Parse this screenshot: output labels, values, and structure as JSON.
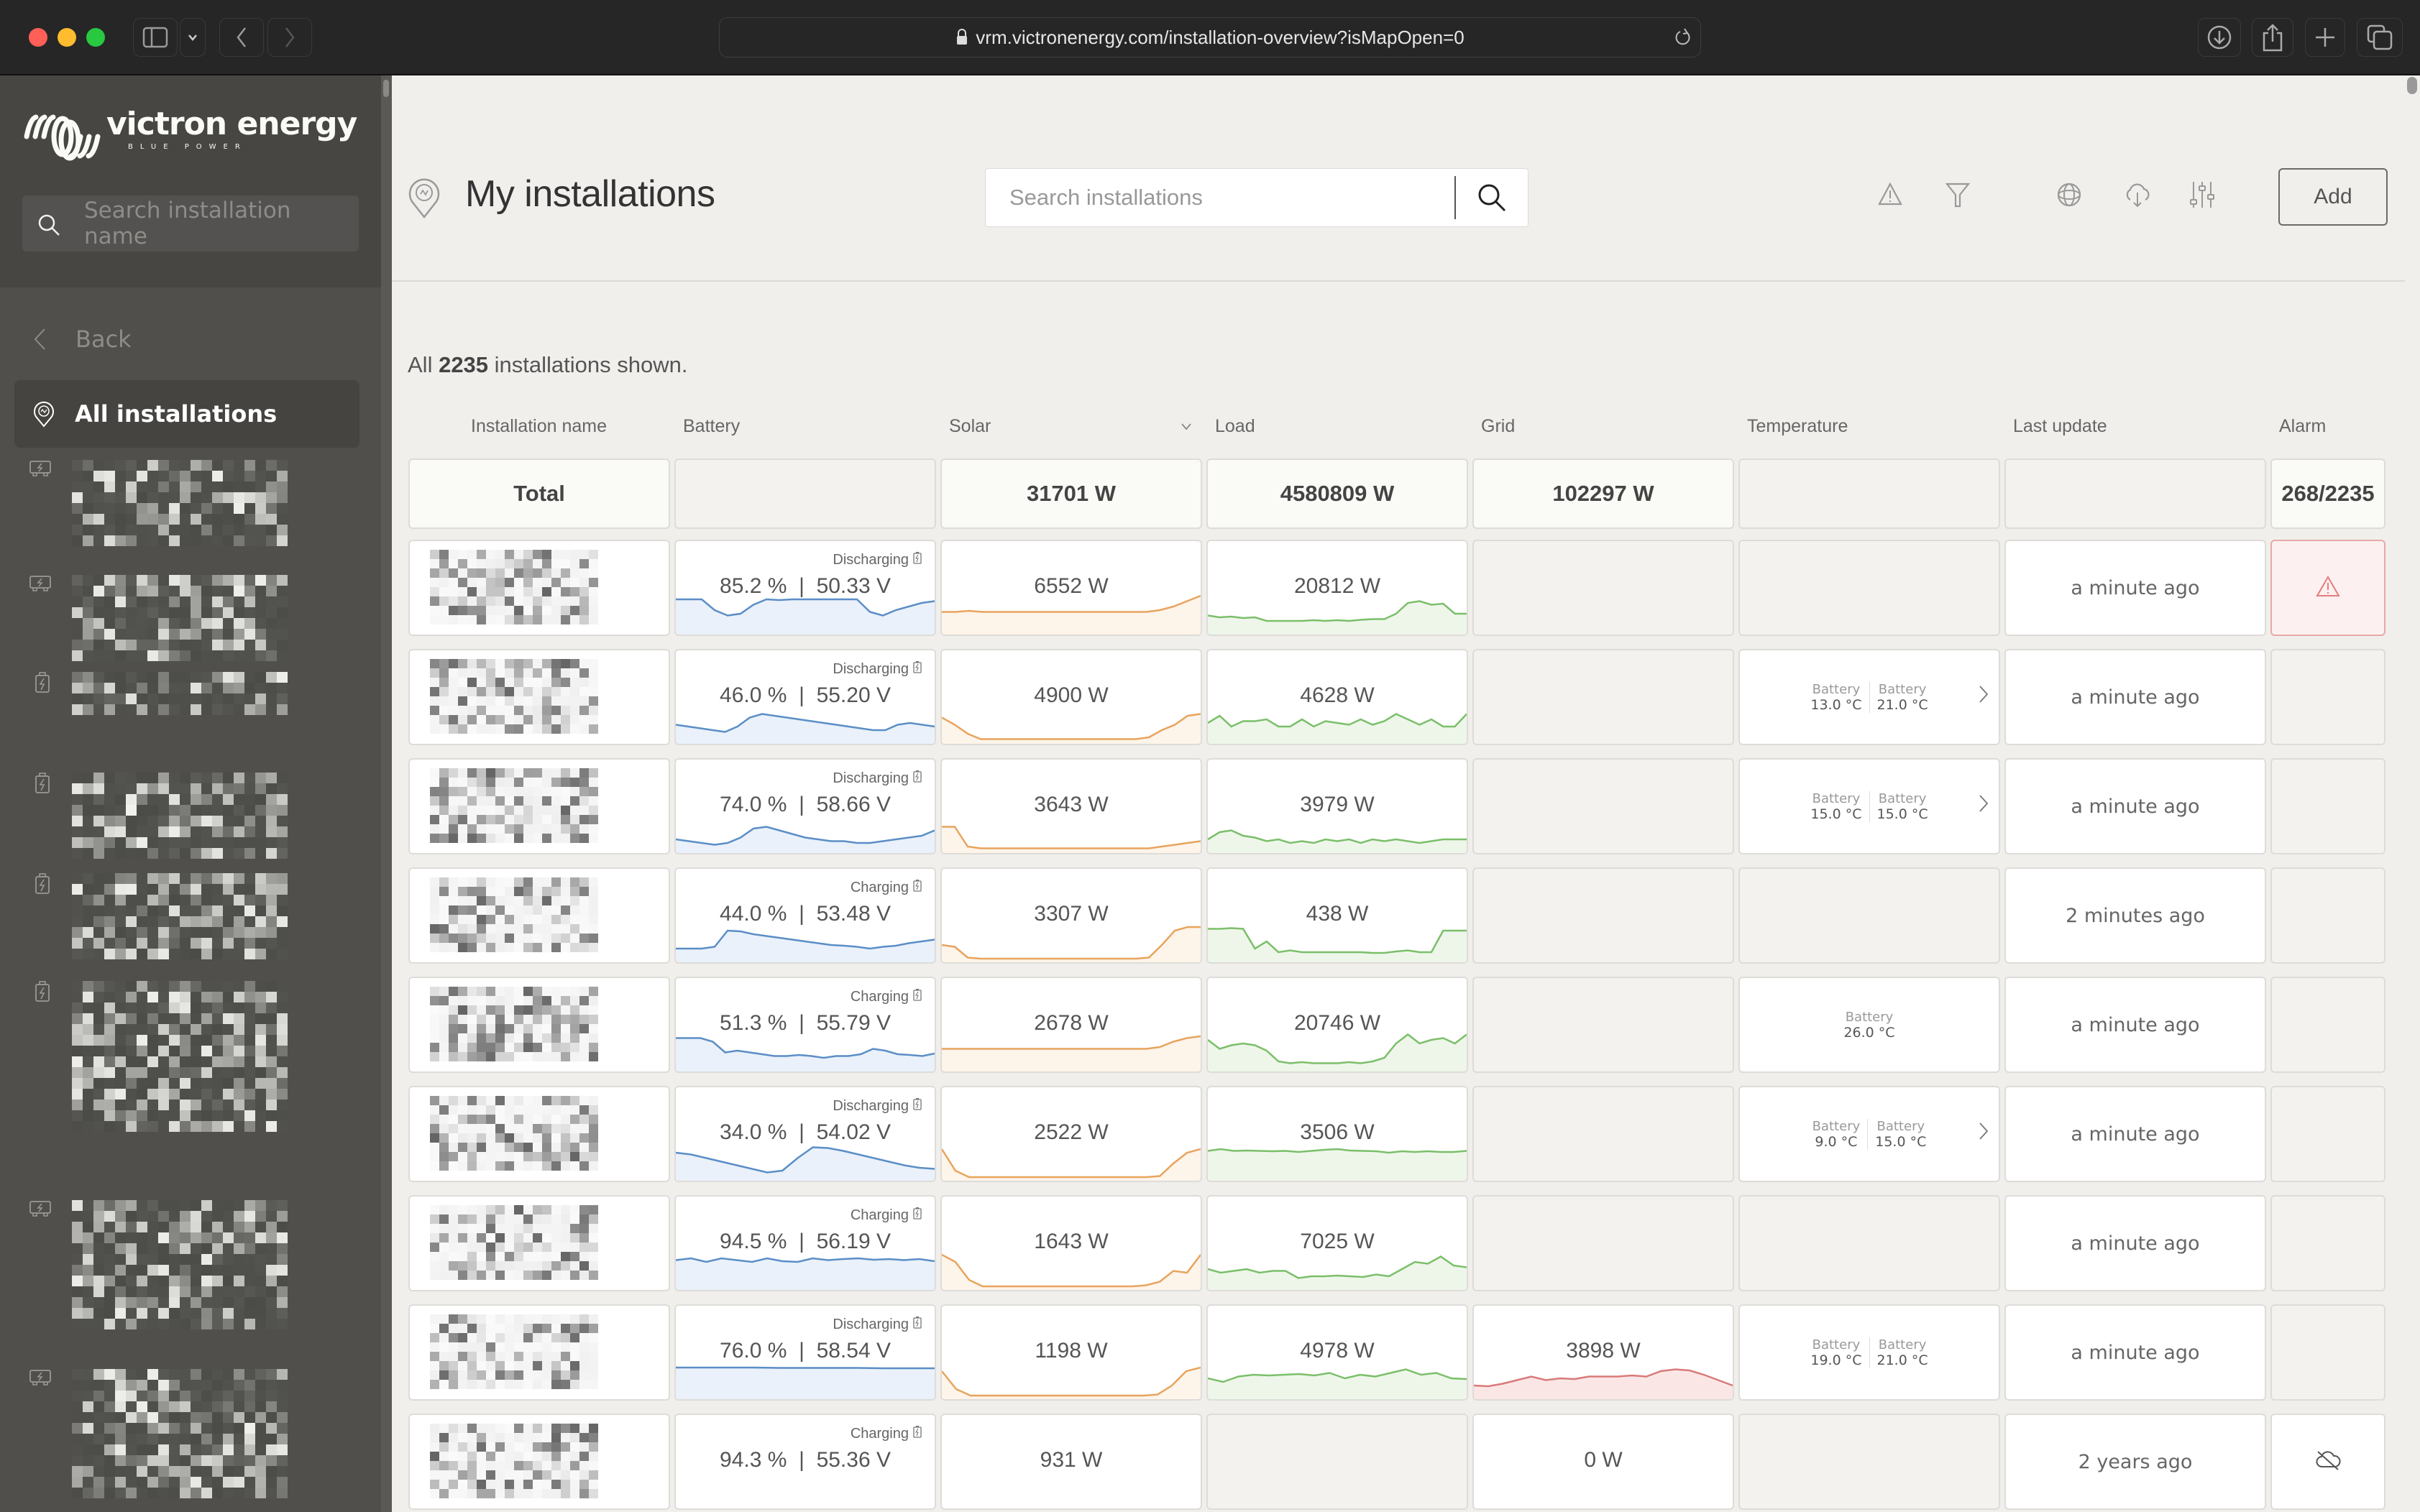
{
  "browser": {
    "url": "vrm.victronenergy.com/installation-overview?isMapOpen=0"
  },
  "sidebar": {
    "brand": "victron energy",
    "tagline": "BLUE POWER",
    "search_placeholder": "Search installation name",
    "back_label": "Back",
    "all_installations_label": "All installations",
    "items": [
      {
        "icon": "inverter-icon",
        "name_redacted": true
      },
      {
        "icon": "inverter-icon",
        "name_redacted": true
      },
      {
        "icon": "battery-charging-icon",
        "name_redacted": true
      },
      {
        "icon": "battery-charging-icon",
        "name_redacted": true
      },
      {
        "icon": "battery-charging-icon",
        "name_redacted": true
      },
      {
        "icon": "battery-charging-icon",
        "name_redacted": true
      },
      {
        "icon": "inverter-icon",
        "name_redacted": true
      },
      {
        "icon": "inverter-icon",
        "name_redacted": true
      }
    ]
  },
  "header": {
    "title": "My installations",
    "search_placeholder": "Search installations",
    "add_label": "Add",
    "icons": [
      "alarm-icon",
      "filter-icon",
      "globe-icon",
      "cloud-download-icon",
      "sliders-icon"
    ]
  },
  "summary": {
    "prefix": "All",
    "count": "2235",
    "suffix": "installations shown."
  },
  "columns": [
    "Installation name",
    "Battery",
    "Solar",
    "Load",
    "Grid",
    "Temperature",
    "Last update",
    "Alarm"
  ],
  "sort_column": "Solar",
  "totals": {
    "label": "Total",
    "solar": "31701 W",
    "load": "4580809 W",
    "grid": "102297 W",
    "alarm": "268/2235"
  },
  "colors": {
    "battery": "#5b8ec6",
    "solar": "#e8a45e",
    "load": "#7bbf6a",
    "grid": "#d97a7a",
    "alarm": "#e27d7d"
  },
  "rows": [
    {
      "name_redacted": true,
      "battery_status": "Discharging",
      "battery": "85.2 %",
      "voltage": "50.33 V",
      "solar": "6552 W",
      "load": "20812 W",
      "grid": null,
      "temps": [],
      "last_update": "a minute ago",
      "alarm": "alarm-active",
      "spark_battery": [
        0.9,
        0.9,
        0.9,
        0.6,
        0.45,
        0.5,
        0.75,
        0.9,
        0.88,
        0.9,
        0.9,
        0.9,
        0.9,
        0.9,
        0.9,
        0.55,
        0.45,
        0.6,
        0.7,
        0.8,
        0.85
      ],
      "spark_solar": [
        0.55,
        0.55,
        0.58,
        0.55,
        0.55,
        0.55,
        0.55,
        0.55,
        0.55,
        0.55,
        0.55,
        0.55,
        0.55,
        0.55,
        0.55,
        0.55,
        0.6,
        0.7,
        0.85,
        1.0
      ],
      "spark_load": [
        0.45,
        0.4,
        0.42,
        0.38,
        0.4,
        0.3,
        0.3,
        0.3,
        0.3,
        0.32,
        0.3,
        0.32,
        0.3,
        0.33,
        0.35,
        0.35,
        0.5,
        0.8,
        0.85,
        0.75,
        0.78,
        0.5,
        0.5
      ]
    },
    {
      "name_redacted": true,
      "battery_status": "Discharging",
      "battery": "46.0 %",
      "voltage": "55.20 V",
      "solar": "4900 W",
      "load": "4628 W",
      "grid": null,
      "temps": [
        {
          "label": "Battery",
          "value": "13.0 °C"
        },
        {
          "label": "Battery",
          "value": "21.0 °C"
        }
      ],
      "temps_more": true,
      "last_update": "a minute ago",
      "alarm": null,
      "spark_battery": [
        0.45,
        0.4,
        0.35,
        0.3,
        0.25,
        0.4,
        0.65,
        0.75,
        0.7,
        0.65,
        0.6,
        0.55,
        0.5,
        0.45,
        0.4,
        0.35,
        0.3,
        0.3,
        0.45,
        0.5,
        0.45,
        0.4
      ],
      "spark_solar": [
        0.65,
        0.45,
        0.2,
        0.05,
        0.05,
        0.05,
        0.05,
        0.05,
        0.05,
        0.05,
        0.05,
        0.05,
        0.05,
        0.05,
        0.05,
        0.05,
        0.1,
        0.3,
        0.45,
        0.7,
        0.75
      ],
      "spark_load": [
        0.5,
        0.7,
        0.4,
        0.55,
        0.55,
        0.6,
        0.4,
        0.4,
        0.6,
        0.4,
        0.55,
        0.5,
        0.45,
        0.6,
        0.45,
        0.55,
        0.75,
        0.6,
        0.45,
        0.6,
        0.4,
        0.4,
        0.75
      ]
    },
    {
      "name_redacted": true,
      "battery_status": "Discharging",
      "battery": "74.0 %",
      "voltage": "58.66 V",
      "solar": "3643 W",
      "load": "3979 W",
      "grid": null,
      "temps": [
        {
          "label": "Battery",
          "value": "15.0 °C"
        },
        {
          "label": "Battery",
          "value": "15.0 °C"
        }
      ],
      "temps_more": true,
      "last_update": "a minute ago",
      "alarm": null,
      "spark_battery": [
        0.3,
        0.25,
        0.2,
        0.15,
        0.2,
        0.35,
        0.6,
        0.65,
        0.55,
        0.45,
        0.35,
        0.3,
        0.25,
        0.25,
        0.2,
        0.2,
        0.25,
        0.3,
        0.35,
        0.4,
        0.55
      ],
      "spark_solar": [
        0.65,
        0.65,
        0.1,
        0.05,
        0.05,
        0.05,
        0.05,
        0.05,
        0.05,
        0.05,
        0.05,
        0.05,
        0.05,
        0.05,
        0.05,
        0.05,
        0.05,
        0.1,
        0.15,
        0.2,
        0.25
      ],
      "spark_load": [
        0.3,
        0.5,
        0.55,
        0.4,
        0.35,
        0.25,
        0.3,
        0.2,
        0.25,
        0.2,
        0.3,
        0.25,
        0.3,
        0.2,
        0.3,
        0.25,
        0.3,
        0.25,
        0.2,
        0.25,
        0.3,
        0.3,
        0.3
      ]
    },
    {
      "name_redacted": true,
      "battery_status": "Charging",
      "battery": "44.0 %",
      "voltage": "53.48 V",
      "solar": "3307 W",
      "load": "438 W",
      "grid": null,
      "temps": [],
      "last_update": "2 minutes ago",
      "alarm": null,
      "spark_battery": [
        0.3,
        0.3,
        0.3,
        0.35,
        0.8,
        0.78,
        0.7,
        0.65,
        0.6,
        0.55,
        0.5,
        0.45,
        0.4,
        0.38,
        0.35,
        0.3,
        0.35,
        0.38,
        0.45,
        0.5,
        0.55
      ],
      "spark_solar": [
        0.4,
        0.35,
        0.05,
        0.02,
        0.02,
        0.02,
        0.02,
        0.02,
        0.02,
        0.02,
        0.02,
        0.02,
        0.02,
        0.02,
        0.02,
        0.02,
        0.05,
        0.4,
        0.8,
        0.9,
        0.9
      ],
      "spark_load": [
        0.85,
        0.85,
        0.87,
        0.85,
        0.3,
        0.5,
        0.2,
        0.25,
        0.2,
        0.2,
        0.2,
        0.2,
        0.2,
        0.2,
        0.18,
        0.18,
        0.22,
        0.25,
        0.2,
        0.2,
        0.8,
        0.8,
        0.8
      ]
    },
    {
      "name_redacted": true,
      "battery_status": "Charging",
      "battery": "51.3 %",
      "voltage": "55.79 V",
      "solar": "2678 W",
      "load": "20746 W",
      "grid": null,
      "temps": [
        {
          "label": "Battery",
          "value": "26.0 °C"
        }
      ],
      "temps_more": false,
      "last_update": "a minute ago",
      "alarm": null,
      "spark_battery": [
        0.85,
        0.85,
        0.85,
        0.75,
        0.45,
        0.5,
        0.45,
        0.4,
        0.35,
        0.35,
        0.38,
        0.35,
        0.3,
        0.35,
        0.35,
        0.4,
        0.55,
        0.5,
        0.4,
        0.38,
        0.35,
        0.42
      ],
      "spark_solar": [
        0.55,
        0.55,
        0.55,
        0.55,
        0.55,
        0.55,
        0.55,
        0.55,
        0.55,
        0.55,
        0.55,
        0.55,
        0.55,
        0.55,
        0.55,
        0.55,
        0.6,
        0.75,
        0.85,
        0.9
      ],
      "spark_load": [
        0.8,
        0.55,
        0.65,
        0.7,
        0.65,
        0.5,
        0.2,
        0.15,
        0.18,
        0.15,
        0.15,
        0.15,
        0.18,
        0.15,
        0.2,
        0.3,
        0.7,
        0.95,
        0.7,
        0.8,
        0.85,
        0.7,
        0.95
      ]
    },
    {
      "name_redacted": true,
      "battery_status": "Discharging",
      "battery": "34.0 %",
      "voltage": "54.02 V",
      "solar": "2522 W",
      "load": "3506 W",
      "grid": null,
      "temps": [
        {
          "label": "Battery",
          "value": "9.0 °C"
        },
        {
          "label": "Battery",
          "value": "15.0 °C"
        }
      ],
      "temps_more": true,
      "last_update": "a minute ago",
      "alarm": null,
      "spark_battery": [
        0.7,
        0.65,
        0.55,
        0.45,
        0.35,
        0.25,
        0.15,
        0.2,
        0.55,
        0.85,
        0.83,
        0.75,
        0.65,
        0.55,
        0.45,
        0.35,
        0.28,
        0.25
      ],
      "spark_solar": [
        0.8,
        0.2,
        0.02,
        0.02,
        0.02,
        0.02,
        0.02,
        0.02,
        0.02,
        0.02,
        0.02,
        0.02,
        0.02,
        0.02,
        0.02,
        0.02,
        0.05,
        0.4,
        0.7,
        0.8
      ],
      "spark_load": [
        0.75,
        0.8,
        0.75,
        0.76,
        0.75,
        0.74,
        0.75,
        0.72,
        0.75,
        0.78,
        0.8,
        0.76,
        0.75,
        0.74,
        0.7,
        0.74,
        0.72,
        0.74,
        0.72,
        0.72,
        0.75
      ]
    },
    {
      "name_redacted": true,
      "battery_status": "Charging",
      "battery": "94.5 %",
      "voltage": "56.19 V",
      "solar": "1643 W",
      "load": "7025 W",
      "grid": null,
      "temps": [],
      "last_update": "a minute ago",
      "alarm": null,
      "spark_battery": [
        0.75,
        0.8,
        0.7,
        0.8,
        0.75,
        0.7,
        0.8,
        0.72,
        0.7,
        0.8,
        0.75,
        0.78,
        0.8,
        0.76,
        0.78,
        0.75,
        0.78,
        0.72
      ],
      "spark_solar": [
        0.9,
        0.7,
        0.2,
        0.02,
        0.02,
        0.02,
        0.02,
        0.02,
        0.02,
        0.02,
        0.02,
        0.02,
        0.02,
        0.02,
        0.02,
        0.05,
        0.15,
        0.45,
        0.4,
        0.9
      ],
      "spark_load": [
        0.5,
        0.4,
        0.45,
        0.5,
        0.4,
        0.45,
        0.45,
        0.25,
        0.3,
        0.3,
        0.32,
        0.3,
        0.28,
        0.35,
        0.3,
        0.5,
        0.7,
        0.65,
        0.85,
        0.6,
        0.55
      ]
    },
    {
      "name_redacted": true,
      "battery_status": "Discharging",
      "battery": "76.0 %",
      "voltage": "58.54 V",
      "solar": "1198 W",
      "load": "4978 W",
      "grid": "3898 W",
      "temps": [
        {
          "label": "Battery",
          "value": "19.0 °C"
        },
        {
          "label": "Battery",
          "value": "21.0 °C"
        }
      ],
      "temps_more": false,
      "last_update": "a minute ago",
      "alarm": null,
      "spark_battery": [
        0.8,
        0.8,
        0.8,
        0.8,
        0.79,
        0.79,
        0.79,
        0.79,
        0.78,
        0.78,
        0.78
      ],
      "spark_solar": [
        0.7,
        0.2,
        0.02,
        0.02,
        0.02,
        0.02,
        0.02,
        0.02,
        0.02,
        0.02,
        0.02,
        0.02,
        0.02,
        0.02,
        0.02,
        0.05,
        0.3,
        0.7,
        0.8
      ],
      "spark_load": [
        0.5,
        0.4,
        0.55,
        0.6,
        0.58,
        0.6,
        0.62,
        0.58,
        0.65,
        0.5,
        0.6,
        0.55,
        0.65,
        0.75,
        0.6,
        0.65,
        0.5,
        0.48
      ],
      "spark_grid": [
        0.3,
        0.28,
        0.35,
        0.45,
        0.55,
        0.45,
        0.5,
        0.48,
        0.55,
        0.55,
        0.55,
        0.58,
        0.55,
        0.7,
        0.75,
        0.72,
        0.6,
        0.45,
        0.3
      ]
    },
    {
      "name_redacted": true,
      "battery_status": "Charging",
      "battery": "94.3 %",
      "voltage": "55.36 V",
      "solar": "931 W",
      "load": null,
      "grid": "0 W",
      "temps": [],
      "last_update": "2 years ago",
      "alarm": "offline"
    }
  ]
}
